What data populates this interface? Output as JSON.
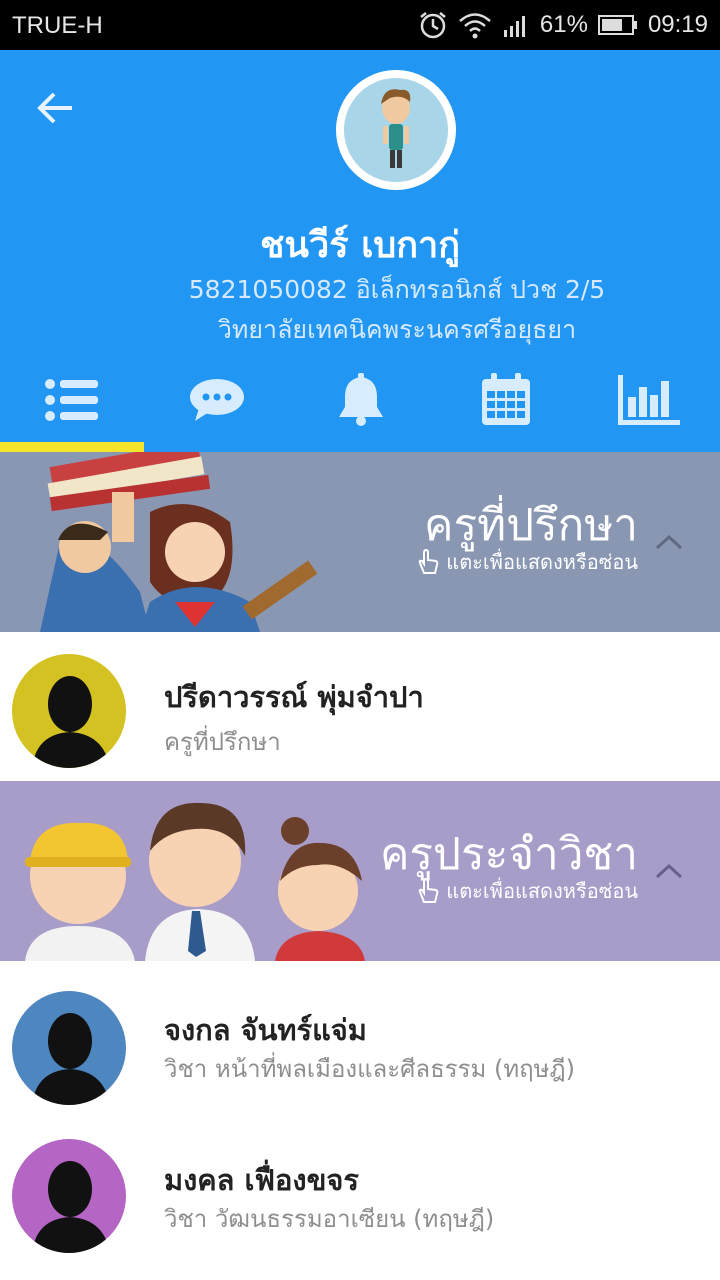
{
  "status": {
    "carrier": "TRUE-H",
    "battery": "61%",
    "time": "09:19"
  },
  "profile": {
    "name": "ชนวีร์ เบกากู่",
    "line1": "5821050082 อิเล็กทรอนิกส์ ปวช 2/5",
    "line2": "วิทยาลัยเทคนิคพระนครศรีอยุธยา"
  },
  "tabs": [
    "list-icon",
    "chat-icon",
    "bell-icon",
    "calendar-icon",
    "bar-chart-icon"
  ],
  "sections": {
    "advisor": {
      "title": "ครูที่ปรึกษา",
      "hint": "แตะเพื่อแสดงหรือซ่อน"
    },
    "subject": {
      "title": "ครูประจำวิชา",
      "hint": "แตะเพื่อแสดงหรือซ่อน"
    }
  },
  "advisor": {
    "name": "ปรีดาวรรณ์ พุ่มจำปา",
    "role": "ครูที่ปรึกษา",
    "avatar_color": "#d4c222"
  },
  "subject_teachers": [
    {
      "name": "จงกล จันทร์แจ่ม",
      "role": "วิชา หน้าที่พลเมืองและศีลธรรม (ทฤษฎี)",
      "avatar_color": "#4e86c0"
    },
    {
      "name": "มงคล เฟื่องขจร",
      "role": "วิชา วัฒนธรรมอาเซียน (ทฤษฎี)",
      "avatar_color": "#b565c4"
    }
  ],
  "colors": {
    "header": "#2196f3",
    "advisor_banner": "#8a97b3",
    "subject_banner": "#a89cc9",
    "indicator": "#f4e52a"
  }
}
